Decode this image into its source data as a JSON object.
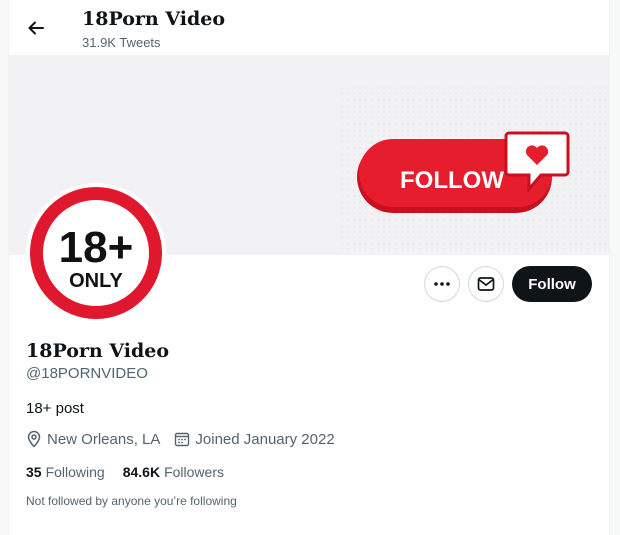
{
  "header": {
    "title": "18Porn Video",
    "tweet_count": "31.9K Tweets"
  },
  "banner": {
    "button_text": "FOLLOW"
  },
  "avatar": {
    "line1": "18+",
    "line2": "ONLY"
  },
  "actions": {
    "more_icon": "ellipsis-icon",
    "message_icon": "envelope-icon",
    "follow_label": "Follow"
  },
  "profile": {
    "name": "18Porn Video",
    "handle": "@18PORNVIDEO",
    "bio": "18+ post",
    "location": "New Orleans, LA",
    "joined": "Joined January 2022",
    "following_count": "35",
    "following_label": "Following",
    "followers_count": "84.6K",
    "followers_label": "Followers",
    "not_followed": "Not followed by anyone you’re following"
  },
  "colors": {
    "banner_bg": "#f2f2f4",
    "badge_red": "#e0182d",
    "follow_btn": "#0f1419",
    "muted_text": "#536471"
  }
}
